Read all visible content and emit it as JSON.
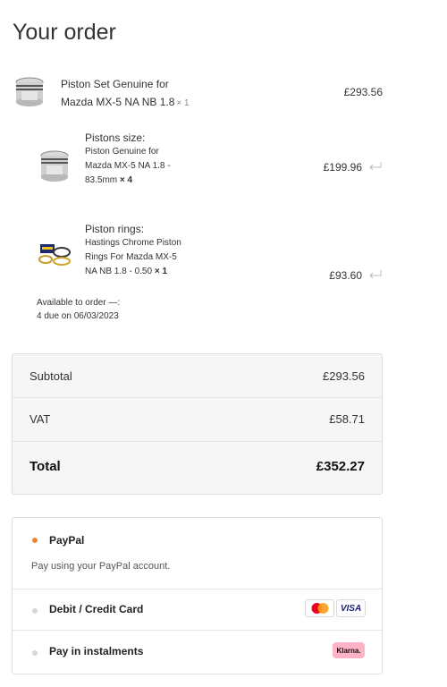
{
  "page": {
    "title": "Your order"
  },
  "order": {
    "main_item": {
      "name_line1": "Piston Set Genuine for",
      "name_line2": "Mazda MX-5 NA NB 1.8",
      "qty": "× 1",
      "price": "£293.56",
      "icon": "piston-set-image"
    },
    "sub_items": [
      {
        "label": "Pistons size:",
        "line1": "Piston Genuine for",
        "line2": "Mazda MX-5 NA 1.8 -",
        "line3": "83.5mm",
        "qty": "× 4",
        "price": "£199.96",
        "icon": "piston-image"
      },
      {
        "label": "Piston rings:",
        "line1": "Hastings Chrome Piston",
        "line2": "Rings For Mazda MX-5",
        "line3": "NA NB 1.8 - 0.50",
        "qty": "× 1",
        "price": "£93.60",
        "icon": "piston-rings-image"
      }
    ],
    "availability_line1": "Available to order —:",
    "availability_line2": "4 due on 06/03/2023"
  },
  "totals": {
    "subtotal_label": "Subtotal",
    "subtotal_value": "£293.56",
    "vat_label": "VAT",
    "vat_value": "£58.71",
    "total_label": "Total",
    "total_value": "£352.27"
  },
  "payments": {
    "paypal_label": "PayPal",
    "paypal_desc": "Pay using your PayPal account.",
    "card_label": "Debit / Credit Card",
    "visa_text": "VISA",
    "instalments_label": "Pay in instalments",
    "klarna_text": "Klarna."
  },
  "colors": {
    "paypal_selected": "#e8873a",
    "radio_unselected": "#d6d6d6",
    "klarna_pink": "#ffb3c7",
    "mastercard_red": "#eb001b",
    "mastercard_orange": "#f79e1b"
  }
}
